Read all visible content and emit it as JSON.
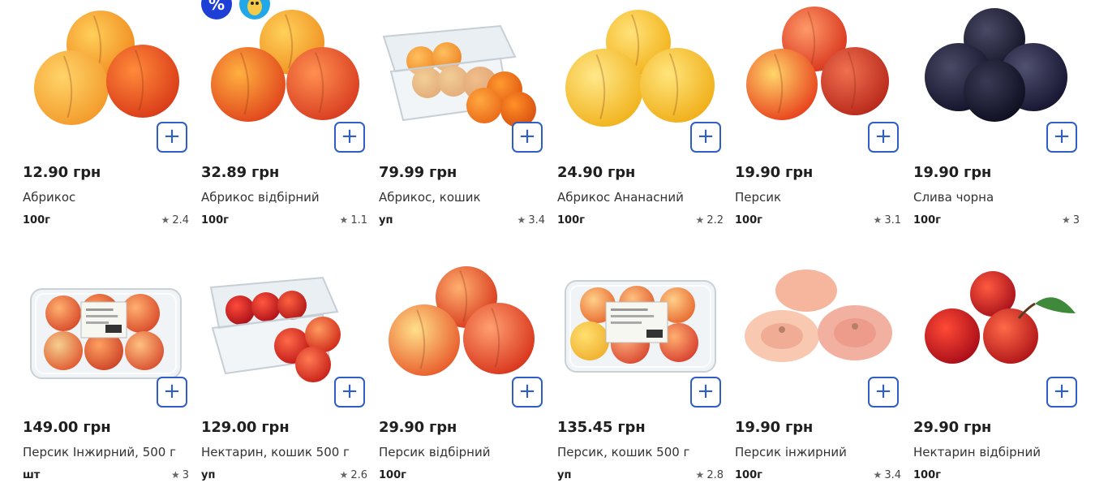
{
  "products": [
    {
      "price": "12.90 грн",
      "name": "Абрикос",
      "unit": "100г",
      "rating": "2.4",
      "image": "apricots"
    },
    {
      "price": "32.89 грн",
      "name": "Абрикос відбірний",
      "unit": "100г",
      "rating": "1.1",
      "image": "apricots-red",
      "badges": [
        "percent-badge-icon",
        "mascot-badge-icon"
      ]
    },
    {
      "price": "79.99 грн",
      "name": "Абрикос, кошик",
      "unit": "уп",
      "rating": "3.4",
      "image": "apricot-basket"
    },
    {
      "price": "24.90 грн",
      "name": "Абрикос Ананасний",
      "unit": "100г",
      "rating": "2.2",
      "image": "apricots-yellow"
    },
    {
      "price": "19.90 грн",
      "name": "Персик",
      "unit": "100г",
      "rating": "3.1",
      "image": "peaches"
    },
    {
      "price": "19.90 грн",
      "name": "Слива чорна",
      "unit": "100г",
      "rating": "3",
      "image": "plums"
    },
    {
      "price": "149.00 грн",
      "name": "Персик Інжирний, 500 г",
      "unit": "шт",
      "rating": "3",
      "image": "fig-peach-pack"
    },
    {
      "price": "129.00 грн",
      "name": "Нектарин, кошик 500 г",
      "unit": "уп",
      "rating": "2.6",
      "image": "nectarine-basket"
    },
    {
      "price": "29.90 грн",
      "name": "Персик відбірний",
      "unit": "100г",
      "rating": "",
      "image": "peaches-select"
    },
    {
      "price": "135.45 грн",
      "name": "Персик, кошик 500 г",
      "unit": "уп",
      "rating": "2.8",
      "image": "peach-basket"
    },
    {
      "price": "19.90 грн",
      "name": "Персик інжирний",
      "unit": "100г",
      "rating": "3.4",
      "image": "fig-peaches"
    },
    {
      "price": "29.90 грн",
      "name": "Нектарин відбірний",
      "unit": "100г",
      "rating": "",
      "image": "nectarines"
    }
  ],
  "add_label": "+",
  "star_icon": "star-icon",
  "colors": {
    "accent": "#2f5ec4",
    "price": "#1f1f1f",
    "badge_blue": "#1d3fd6",
    "badge_cyan": "#20a8e8"
  }
}
